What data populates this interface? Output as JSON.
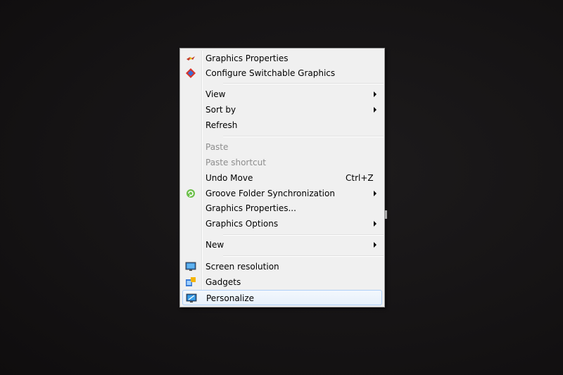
{
  "context_menu": {
    "items": [
      {
        "label": "Graphics Properties",
        "icon": "graphics-properties-icon"
      },
      {
        "label": "Configure Switchable Graphics",
        "icon": "switchable-graphics-icon"
      },
      {
        "label": "View",
        "submenu": true
      },
      {
        "label": "Sort by",
        "submenu": true
      },
      {
        "label": "Refresh"
      },
      {
        "label": "Paste",
        "disabled": true
      },
      {
        "label": "Paste shortcut",
        "disabled": true
      },
      {
        "label": "Undo Move",
        "shortcut": "Ctrl+Z"
      },
      {
        "label": "Groove Folder Synchronization",
        "icon": "groove-icon",
        "submenu": true
      },
      {
        "label": "Graphics Properties..."
      },
      {
        "label": "Graphics Options",
        "submenu": true
      },
      {
        "label": "New",
        "submenu": true
      },
      {
        "label": "Screen resolution",
        "icon": "screen-resolution-icon"
      },
      {
        "label": "Gadgets",
        "icon": "gadgets-icon"
      },
      {
        "label": "Personalize",
        "icon": "personalize-icon",
        "highlighted": true
      }
    ]
  },
  "colors": {
    "desktop_background": "#151314",
    "menu_background": "#f0f0f0",
    "disabled_text": "#8d8d8d",
    "highlight_border": "#aecff7"
  }
}
